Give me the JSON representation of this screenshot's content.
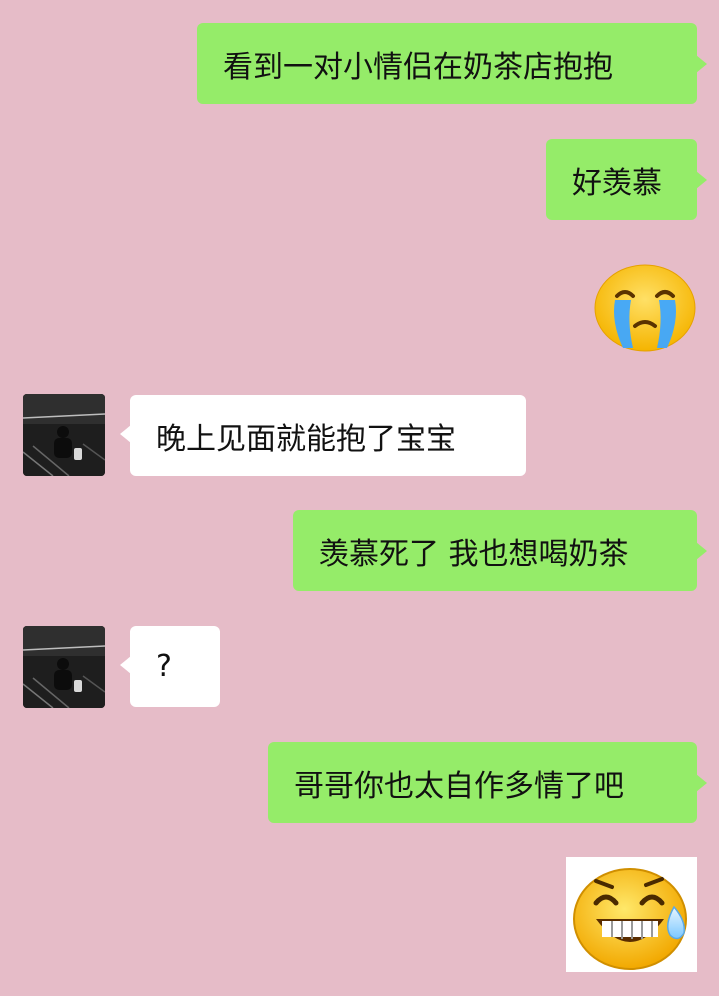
{
  "messages": [
    {
      "side": "out",
      "text": "看到一对小情侣在奶茶店抱抱"
    },
    {
      "side": "out",
      "text": "好羡慕"
    },
    {
      "side": "out",
      "sticker": "crying-face-sticker"
    },
    {
      "side": "in",
      "text": "晚上见面就能抱了宝宝"
    },
    {
      "side": "out",
      "text": "羡慕死了 我也想喝奶茶"
    },
    {
      "side": "in",
      "text": "?"
    },
    {
      "side": "out",
      "text": "哥哥你也太自作多情了吧"
    },
    {
      "side": "out",
      "sticker": "laughing-sweat-face-sticker"
    }
  ],
  "colors": {
    "background": "#e6bcc8",
    "outgoing_bubble": "#95ec69",
    "incoming_bubble": "#ffffff"
  }
}
